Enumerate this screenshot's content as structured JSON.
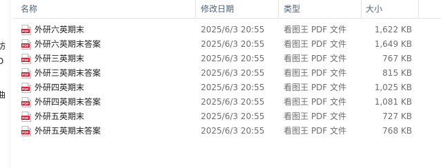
{
  "left_pane": {
    "fragments": [
      "坊",
      "D",
      "曲"
    ]
  },
  "columns": {
    "name": "名称",
    "date": "修改日期",
    "type": "类型",
    "size": "大小"
  },
  "files": [
    {
      "name": "外研六英期末",
      "date": "2025/6/3 20:55",
      "type": "看图王 PDF 文件",
      "size": "1,622 KB",
      "icon": "pdf-icon"
    },
    {
      "name": "外研六英期末答案",
      "date": "2025/6/3 20:55",
      "type": "看图王 PDF 文件",
      "size": "1,649 KB",
      "icon": "pdf-icon"
    },
    {
      "name": "外研三英期末",
      "date": "2025/6/3 20:55",
      "type": "看图王 PDF 文件",
      "size": "767 KB",
      "icon": "pdf-icon"
    },
    {
      "name": "外研三英期末答案",
      "date": "2025/6/3 20:55",
      "type": "看图王 PDF 文件",
      "size": "815 KB",
      "icon": "pdf-icon"
    },
    {
      "name": "外研四英期末",
      "date": "2025/6/3 20:55",
      "type": "看图王 PDF 文件",
      "size": "1,025 KB",
      "icon": "pdf-icon"
    },
    {
      "name": "外研四英期末答案",
      "date": "2025/6/3 20:55",
      "type": "看图王 PDF 文件",
      "size": "1,081 KB",
      "icon": "pdf-icon"
    },
    {
      "name": "外研五英期末",
      "date": "2025/6/3 20:55",
      "type": "看图王 PDF 文件",
      "size": "727 KB",
      "icon": "pdf-icon"
    },
    {
      "name": "外研五英期末答案",
      "date": "2025/6/3 20:55",
      "type": "看图王 PDF 文件",
      "size": "768 KB",
      "icon": "pdf-icon"
    }
  ],
  "colors": {
    "header_text": "#4c607a",
    "pdf_red": "#d0021b"
  }
}
